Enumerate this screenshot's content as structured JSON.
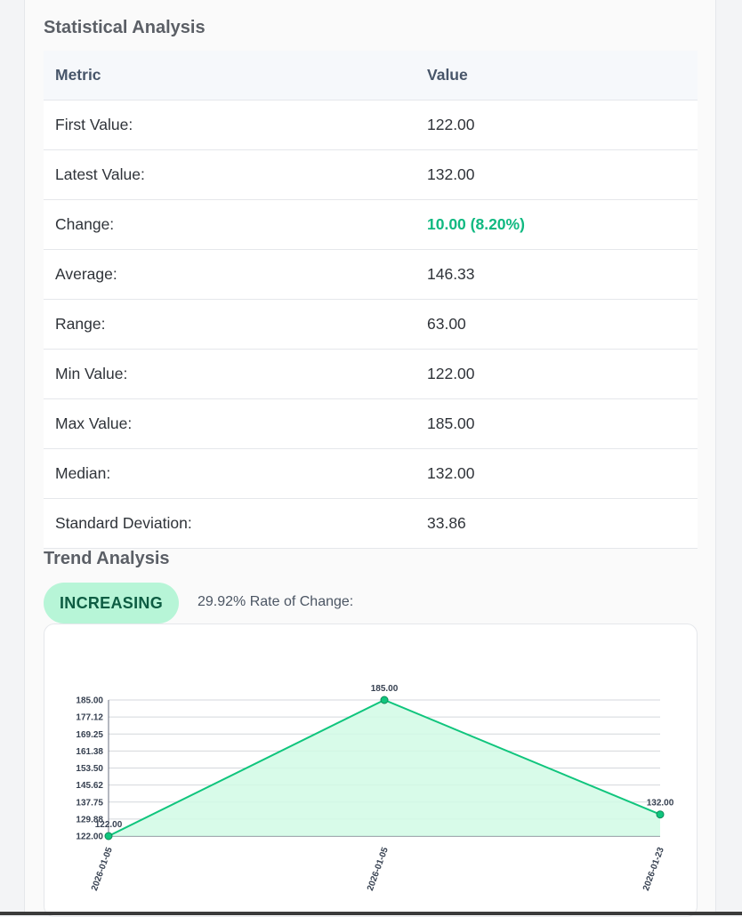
{
  "stats_section": {
    "title": "Statistical Analysis",
    "header": {
      "metric": "Metric",
      "value": "Value"
    },
    "rows": [
      {
        "label": "First Value:",
        "value": "122.00"
      },
      {
        "label": "Latest Value:",
        "value": "132.00"
      },
      {
        "label": "Change:",
        "value": "10.00 (8.20%)"
      },
      {
        "label": "Average:",
        "value": "146.33"
      },
      {
        "label": "Range:",
        "value": "63.00"
      },
      {
        "label": "Min Value:",
        "value": "122.00"
      },
      {
        "label": "Max Value:",
        "value": "185.00"
      },
      {
        "label": "Median:",
        "value": "132.00"
      },
      {
        "label": "Standard Deviation:",
        "value": "33.86"
      }
    ]
  },
  "trend_section": {
    "title": "Trend Analysis",
    "badge": "INCREASING",
    "rate_text": "29.92% Rate of Change:"
  },
  "colors": {
    "positive": "#10b981",
    "line": "#10c57d",
    "fill": "#d1fae5",
    "badge_bg": "#b7f5d7"
  },
  "chart_data": {
    "type": "line",
    "x": [
      "2026-01-05",
      "2026-01-05",
      "2026-01-23"
    ],
    "values": [
      122.0,
      185.0,
      132.0
    ],
    "point_labels": [
      "122.00",
      "185.00",
      "132.00"
    ],
    "y_ticks": [
      "185.00",
      "177.12",
      "169.25",
      "161.38",
      "153.50",
      "145.62",
      "137.75",
      "129.88",
      "122.00"
    ],
    "ylim": [
      122.0,
      185.0
    ],
    "grid": true,
    "area_fill": true
  }
}
